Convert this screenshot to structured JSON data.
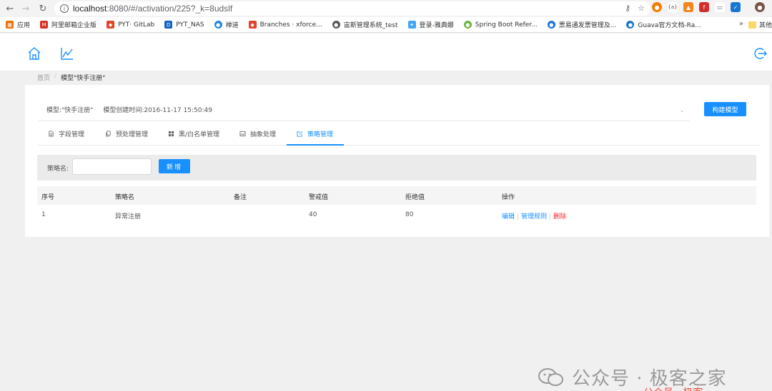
{
  "browser": {
    "url_host": "localhost",
    "url_path": ":8080/#/activation/225?_k=8udslf"
  },
  "bookmarks": [
    {
      "label": "应用",
      "color": "#e8710a"
    },
    {
      "label": "阿里邮箱企业版",
      "color": "#d93025"
    },
    {
      "label": "PYT· GitLab",
      "color": "#e24329"
    },
    {
      "label": "PYT_NAS",
      "color": "#1565c0"
    },
    {
      "label": "禅道",
      "color": "#1e88e5"
    },
    {
      "label": "Branches · xforce...",
      "color": "#e24329"
    },
    {
      "label": "宙斯管理系统_test",
      "color": "#555555"
    },
    {
      "label": "登录-雅典娜",
      "color": "#42a5f5"
    },
    {
      "label": "Spring Boot Refer...",
      "color": "#6db33f"
    },
    {
      "label": "票易通发票管理及...",
      "color": "#1a73e8"
    },
    {
      "label": "Guava官方文档-Ra...",
      "color": "#1976d2"
    }
  ],
  "bookmarks_more": "»",
  "bookmarks_other": "其他",
  "breadcrumb": {
    "home": "首页",
    "sep": "/",
    "current": "模型\"快手注册\""
  },
  "model": {
    "name_label": "模型:\"快手注册\"",
    "created_label": "模型创建时间:2016-11-17 15:50:49"
  },
  "build_button": "构建模型",
  "tabs": [
    {
      "label": "字段管理",
      "active": false
    },
    {
      "label": "预处理管理",
      "active": false
    },
    {
      "label": "黑/白名单管理",
      "active": false
    },
    {
      "label": "抽象处理",
      "active": false
    },
    {
      "label": "策略管理",
      "active": true
    }
  ],
  "search": {
    "label": "策略名:",
    "placeholder": "",
    "add_button": "新增"
  },
  "table": {
    "headers": [
      "序号",
      "策略名",
      "备注",
      "警戒值",
      "拒绝值",
      "操作"
    ],
    "rows": [
      {
        "index": "1",
        "name": "异常注册",
        "remark": "",
        "warn": "40",
        "reject": "80"
      }
    ],
    "ops": {
      "edit": "编辑",
      "manage": "管理规则",
      "delete": "删除",
      "sep": "|"
    }
  },
  "watermark": {
    "text": "公众号 · 极客之家",
    "sub": "公众号 · 极客"
  },
  "colors": {
    "primary": "#1890ff",
    "danger": "#f5222d"
  }
}
